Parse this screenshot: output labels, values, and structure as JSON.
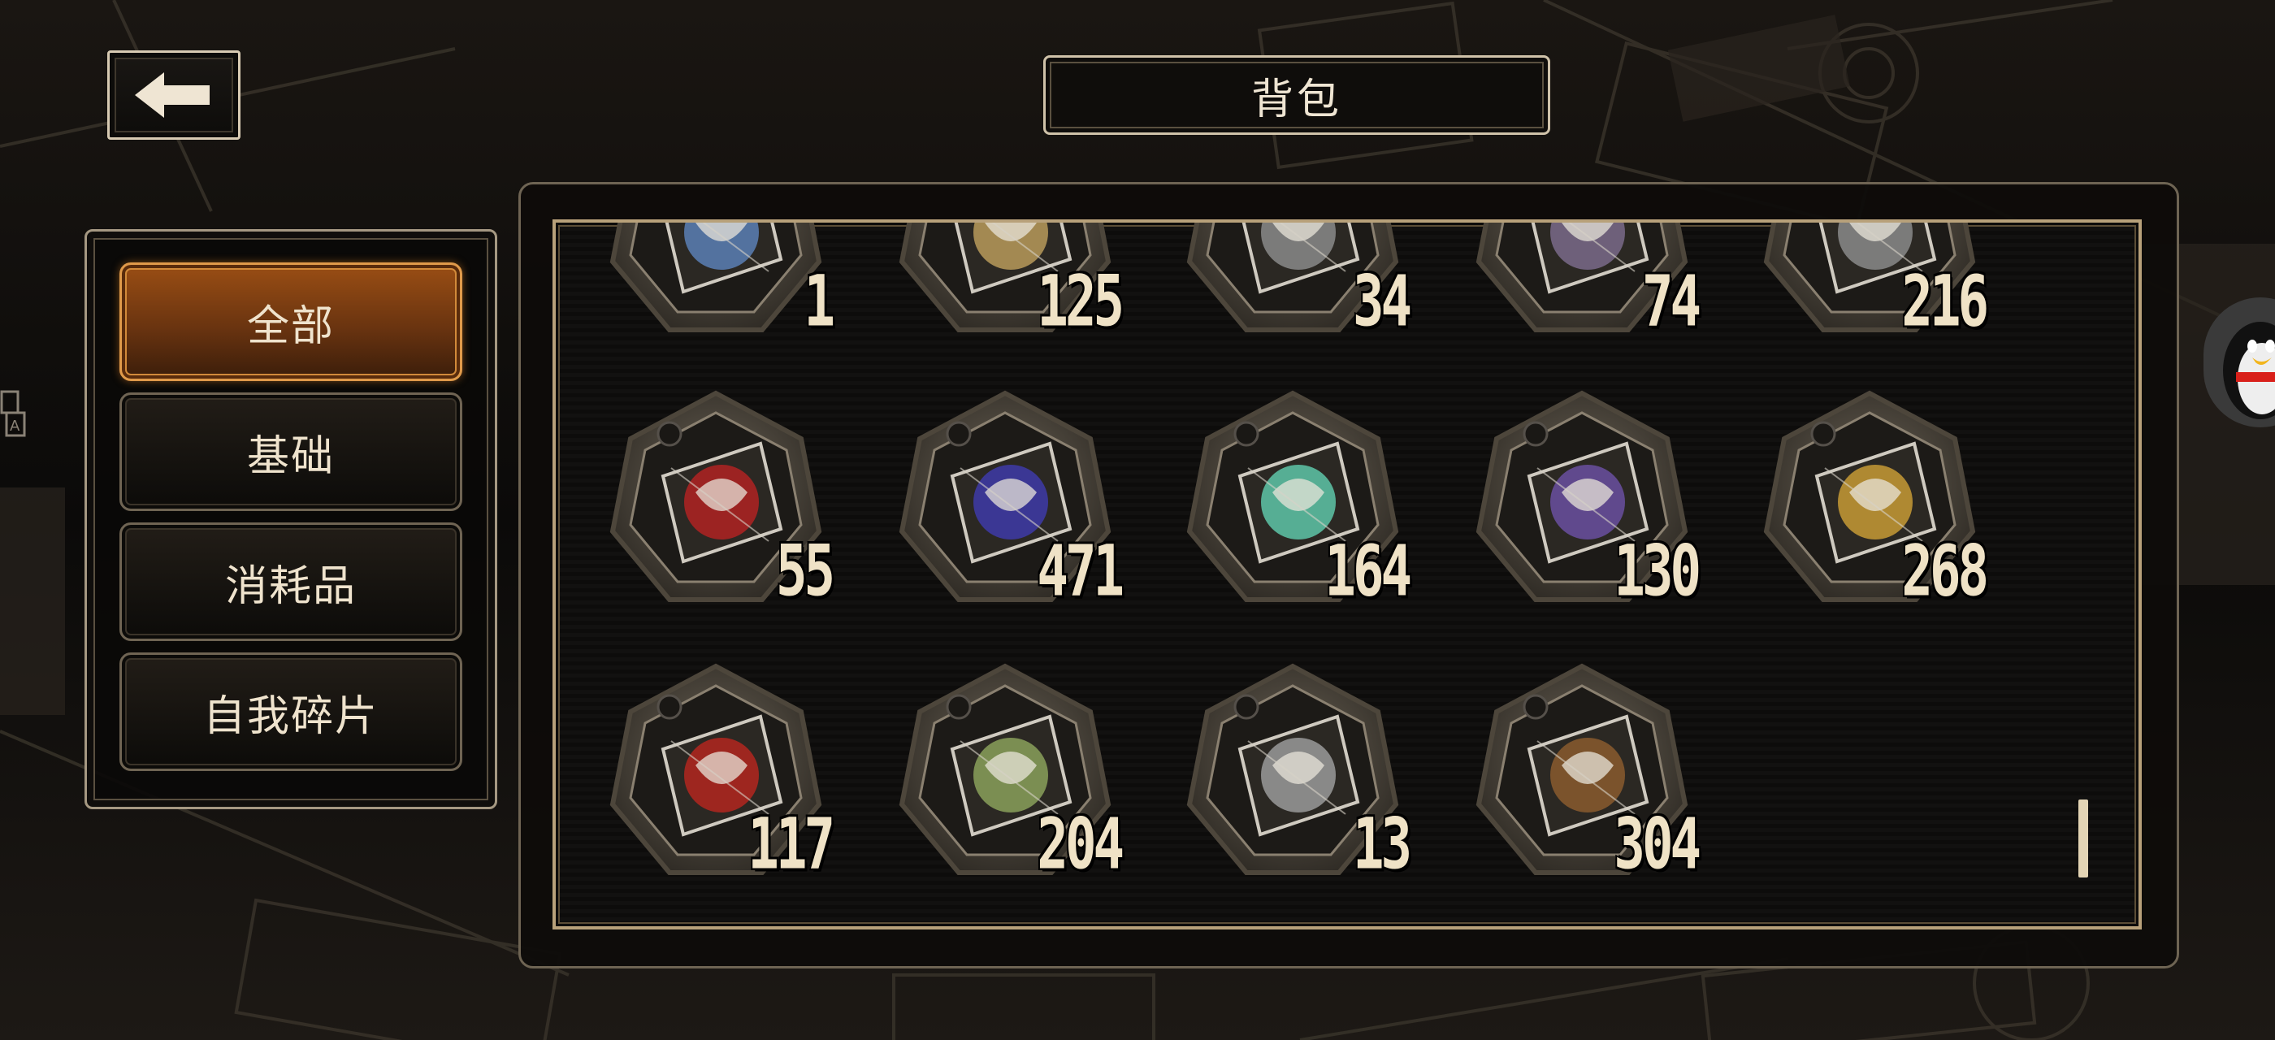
{
  "header": {
    "back_icon": "arrow-left-icon",
    "title": "背包"
  },
  "tabs": [
    {
      "label": "全部",
      "active": true
    },
    {
      "label": "基础",
      "active": false
    },
    {
      "label": "消耗品",
      "active": false
    },
    {
      "label": "自我碎片",
      "active": false
    }
  ],
  "items": [
    {
      "count": "1",
      "icon": "penguin-emblem-icon",
      "color": "#5b7fb5"
    },
    {
      "count": "125",
      "icon": "gold-ornament-icon",
      "color": "#b89a5a"
    },
    {
      "count": "34",
      "icon": "shard-icon",
      "color": "#8a8a8a"
    },
    {
      "count": "74",
      "icon": "shard-icon",
      "color": "#7a6a8a"
    },
    {
      "count": "216",
      "icon": "shard-icon",
      "color": "#8a8a8a"
    },
    {
      "count": "55",
      "icon": "red-glyph-shard-icon",
      "color": "#b02222"
    },
    {
      "count": "471",
      "icon": "chain-link-shard-icon",
      "color": "#3e3aa8"
    },
    {
      "count": "164",
      "icon": "ringed-planet-shard-icon",
      "color": "#5ec6a8"
    },
    {
      "count": "130",
      "icon": "crescent-moon-shard-icon",
      "color": "#6a4fa0"
    },
    {
      "count": "268",
      "icon": "golden-wreath-compass-shard-icon",
      "color": "#c79a35"
    },
    {
      "count": "117",
      "icon": "red-ribbon-shard-icon",
      "color": "#b3261e"
    },
    {
      "count": "204",
      "icon": "vine-branch-shard-icon",
      "color": "#8aa05a"
    },
    {
      "count": "13",
      "icon": "net-sphere-shard-icon",
      "color": "#9a9a9a"
    },
    {
      "count": "304",
      "icon": "feather-mask-shard-icon",
      "color": "#8a5a2e"
    }
  ],
  "side": {
    "right_icon": "penguin-avatar-icon",
    "left_icon": "translate-icon"
  }
}
